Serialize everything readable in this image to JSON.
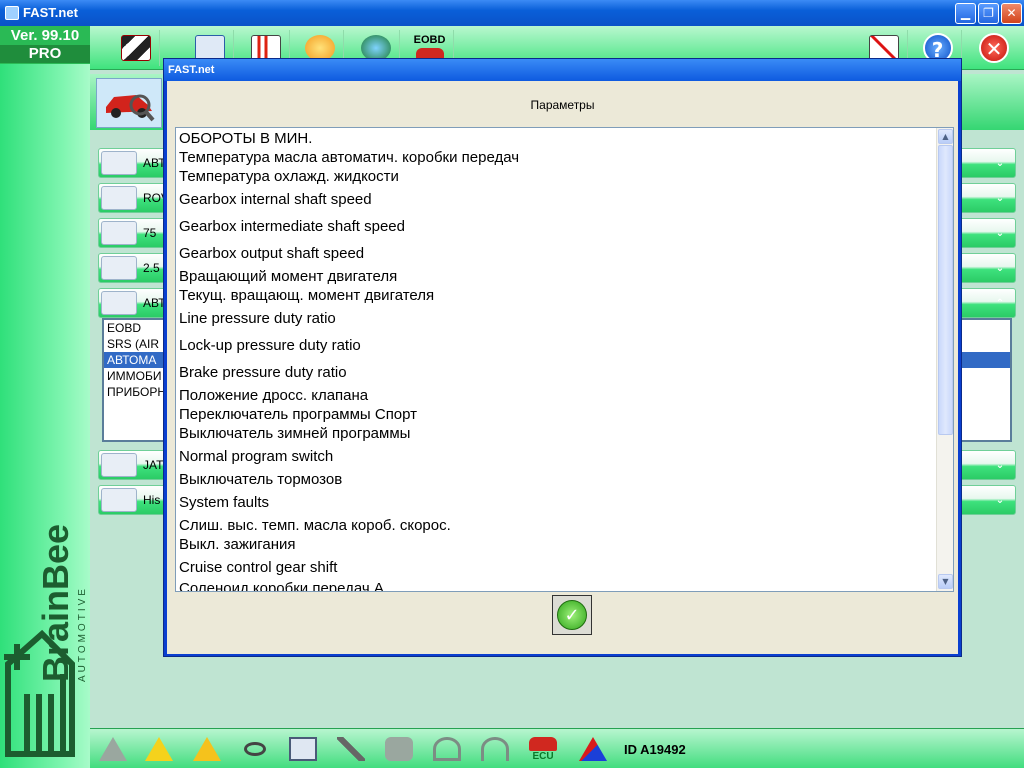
{
  "window": {
    "title": "FAST.net",
    "min_glyph": "▁",
    "max_glyph": "❐",
    "close_glyph": "✕"
  },
  "left": {
    "version": "Ver. 99.10",
    "edition": "PRO",
    "brand": "BrainBee",
    "brand_sub": "AUTOMOTIVE"
  },
  "toolbar": {
    "eobd_label": "EOBD",
    "help_glyph": "?",
    "close_glyph": "✕",
    "icons": [
      "race-flag-icon",
      "checklist-icon",
      "report-chart-icon",
      "wand-icon",
      "globe-icon",
      "eobd-car-icon",
      "graph-icon",
      "help-icon",
      "exit-icon"
    ]
  },
  "nav_rows": [
    {
      "label": "АВТ",
      "icon": "car-service-icon"
    },
    {
      "label": "ROV",
      "icon": "engine-icon"
    },
    {
      "label": "75",
      "icon": "car-model-icon"
    },
    {
      "label": "2.5",
      "icon": "injector-icon"
    },
    {
      "label": "АВТ",
      "icon": "ecu-chip-icon"
    },
    {
      "label": "JAT",
      "icon": "diagnostic-icon"
    },
    {
      "label": "His",
      "icon": "history-icon"
    }
  ],
  "systems": [
    "EOBD",
    "SRS (AIR",
    "АВТОМА",
    "ИММОБИ",
    "ПРИБОРН"
  ],
  "chev_down": "⌄",
  "chev_up": "⌃",
  "dialog": {
    "title": "FAST.net",
    "heading": "Параметры",
    "scroll_up": "▲",
    "scroll_down": "▼",
    "ok_glyph": "✓",
    "params": [
      "ОБОРОТЫ В МИН.",
      "Температура масла автоматич. коробки передач",
      "Температура охлажд. жидкости",
      "Gearbox internal shaft speed",
      "Gearbox intermediate shaft speed",
      "Gearbox output shaft speed",
      "Вращающий момент двигателя",
      "Текущ. вращающ. момент двигателя",
      "Line pressure duty ratio",
      "Lock-up pressure duty ratio",
      "Brake pressure duty ratio",
      "Положение дросс. клапана",
      "Переключатель программы Спорт",
      "Выключатель зимней программы",
      "Normal program switch",
      "Выключатель тормозов",
      "System faults",
      "Слиш. выс. темп. масла короб. скорос.",
      "Выкл. зажигания",
      "Cruise control gear shift",
      "Соленоид коробки передач А"
    ]
  },
  "statusbar": {
    "id_text": "ID A19492",
    "ecu_label": "ECU",
    "icons": [
      "car-lift-icon",
      "warning-icon",
      "warning-tools-icon",
      "glasses-icon",
      "manual-icon",
      "tools-icon",
      "map-icon",
      "cable-icon",
      "probe-icon",
      "ecu-icon",
      "brand-logo-icon"
    ]
  }
}
